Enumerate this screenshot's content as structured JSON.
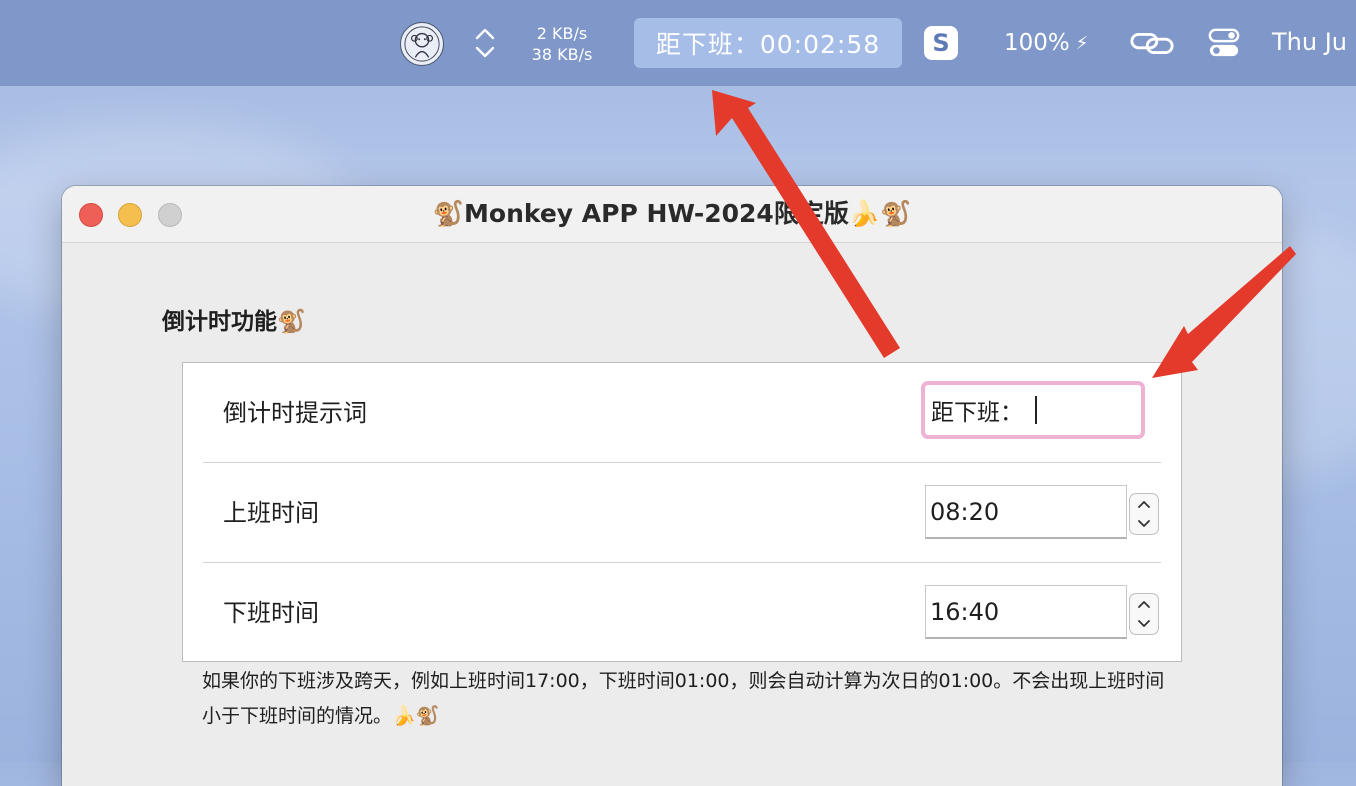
{
  "menubar": {
    "net_up": "2 KB/s",
    "net_down": "38 KB/s",
    "countdown": "距下班：00:02:58",
    "battery": "100%",
    "battery_bolt": "⚡",
    "s_icon_letter": "S",
    "clock": "Thu Ju"
  },
  "window": {
    "title": "🐒Monkey APP HW-2024限定版🍌🐒"
  },
  "countdown_section": {
    "title": "倒计时功能🐒",
    "rows": [
      {
        "label": "倒计时提示词",
        "value": "距下班："
      },
      {
        "label": "上班时间",
        "value": "08:20"
      },
      {
        "label": "下班时间",
        "value": "16:40"
      }
    ],
    "note": "如果你的下班涉及跨天，例如上班时间17:00，下班时间01:00，则会自动计算为次日的01:00。不会出现上班时间小于下班时间的情况。🍌🐒"
  },
  "icons": {
    "monkey": "monkey-logo-icon",
    "network": "network-arrows-icon",
    "sogou": "s-app-icon",
    "link": "link-icon",
    "control_center": "control-center-icon",
    "stepper_up": "chevron-up-icon",
    "stepper_down": "chevron-down-icon"
  },
  "colors": {
    "menubar": "#7f98c9",
    "countdown_bg": "#a6bde8",
    "focus_ring": "#f0b2d3",
    "arrow": "#e33a2c",
    "close": "#ee5f57",
    "minimize": "#f5bf4f",
    "zoom": "#d0d0d0"
  }
}
